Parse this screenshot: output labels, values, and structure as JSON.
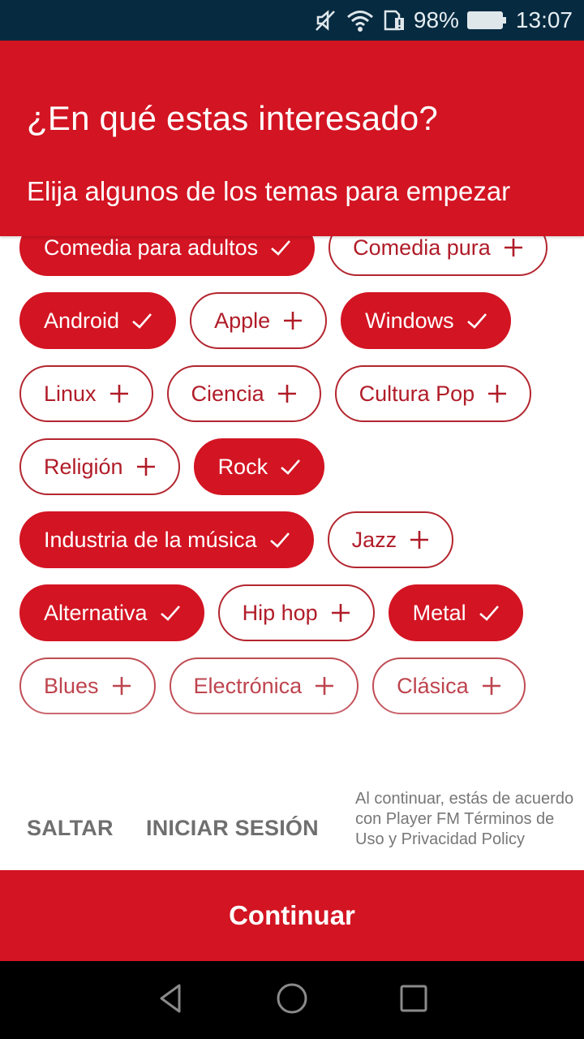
{
  "status_bar": {
    "icons": [
      "mute-icon",
      "wifi-icon",
      "sim-alert-icon",
      "battery-icon"
    ],
    "battery": "98%",
    "time": "13:07"
  },
  "header": {
    "title": "¿En qué estas interesado?",
    "subtitle": "Elija algunos de los temas para empezar"
  },
  "colors": {
    "accent": "#d31422",
    "status_bar": "#062a40"
  },
  "topics": [
    [
      {
        "label": "Comedia para adultos",
        "selected": true
      },
      {
        "label": "Comedia pura",
        "selected": false
      }
    ],
    [
      {
        "label": "Android",
        "selected": true
      },
      {
        "label": "Apple",
        "selected": false
      },
      {
        "label": "Windows",
        "selected": true
      }
    ],
    [
      {
        "label": "Linux",
        "selected": false
      },
      {
        "label": "Ciencia",
        "selected": false
      },
      {
        "label": "Cultura Pop",
        "selected": false
      }
    ],
    [
      {
        "label": "Religión",
        "selected": false
      },
      {
        "label": "Rock",
        "selected": true
      }
    ],
    [
      {
        "label": "Industria de la música",
        "selected": true
      },
      {
        "label": "Jazz",
        "selected": false
      }
    ],
    [
      {
        "label": "Alternativa",
        "selected": true
      },
      {
        "label": "Hip hop",
        "selected": false
      },
      {
        "label": "Metal",
        "selected": true
      }
    ],
    [
      {
        "label": "Blues",
        "selected": false
      },
      {
        "label": "Electrónica",
        "selected": false
      },
      {
        "label": "Clásica",
        "selected": false
      }
    ]
  ],
  "footer": {
    "skip_label": "SALTAR",
    "login_label": "INICIAR SESIÓN",
    "legal_text": "Al continuar, estás de acuerdo con Player FM Términos de Uso y Privacidad Policy"
  },
  "continue_label": "Continuar",
  "nav_bar": {
    "icons": [
      "back-icon",
      "home-icon",
      "recents-icon"
    ]
  }
}
